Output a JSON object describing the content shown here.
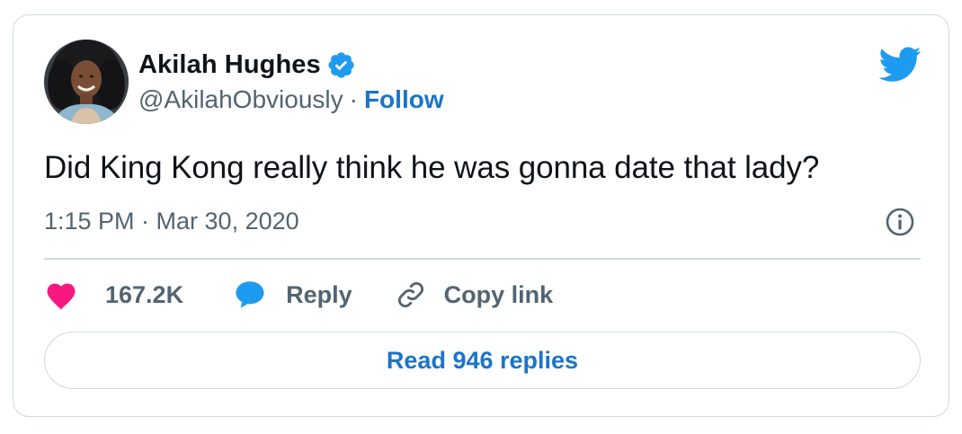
{
  "author": {
    "display_name": "Akilah Hughes",
    "handle": "@AkilahObviously",
    "separator": "·",
    "follow_label": "Follow",
    "avatar_icon": "profile-photo",
    "verified_icon": "verified-badge-icon"
  },
  "tweet": {
    "text": "Did King Kong really think he was gonna date that lady?",
    "timestamp": "1:15 PM · Mar 30, 2020"
  },
  "actions": {
    "likes_count": "167.2K",
    "reply_label": "Reply",
    "copy_link_label": "Copy link"
  },
  "read_replies_label": "Read 946 replies",
  "colors": {
    "twitter_blue": "#1d9bf0",
    "link_blue": "#1b74c8",
    "like_pink": "#f91880",
    "muted_text": "#536471",
    "border": "#cfd9de"
  },
  "icons": {
    "brand": "twitter-bird-icon",
    "info": "info-icon",
    "like": "heart-icon",
    "reply": "speech-bubble-icon",
    "copy": "link-icon"
  }
}
